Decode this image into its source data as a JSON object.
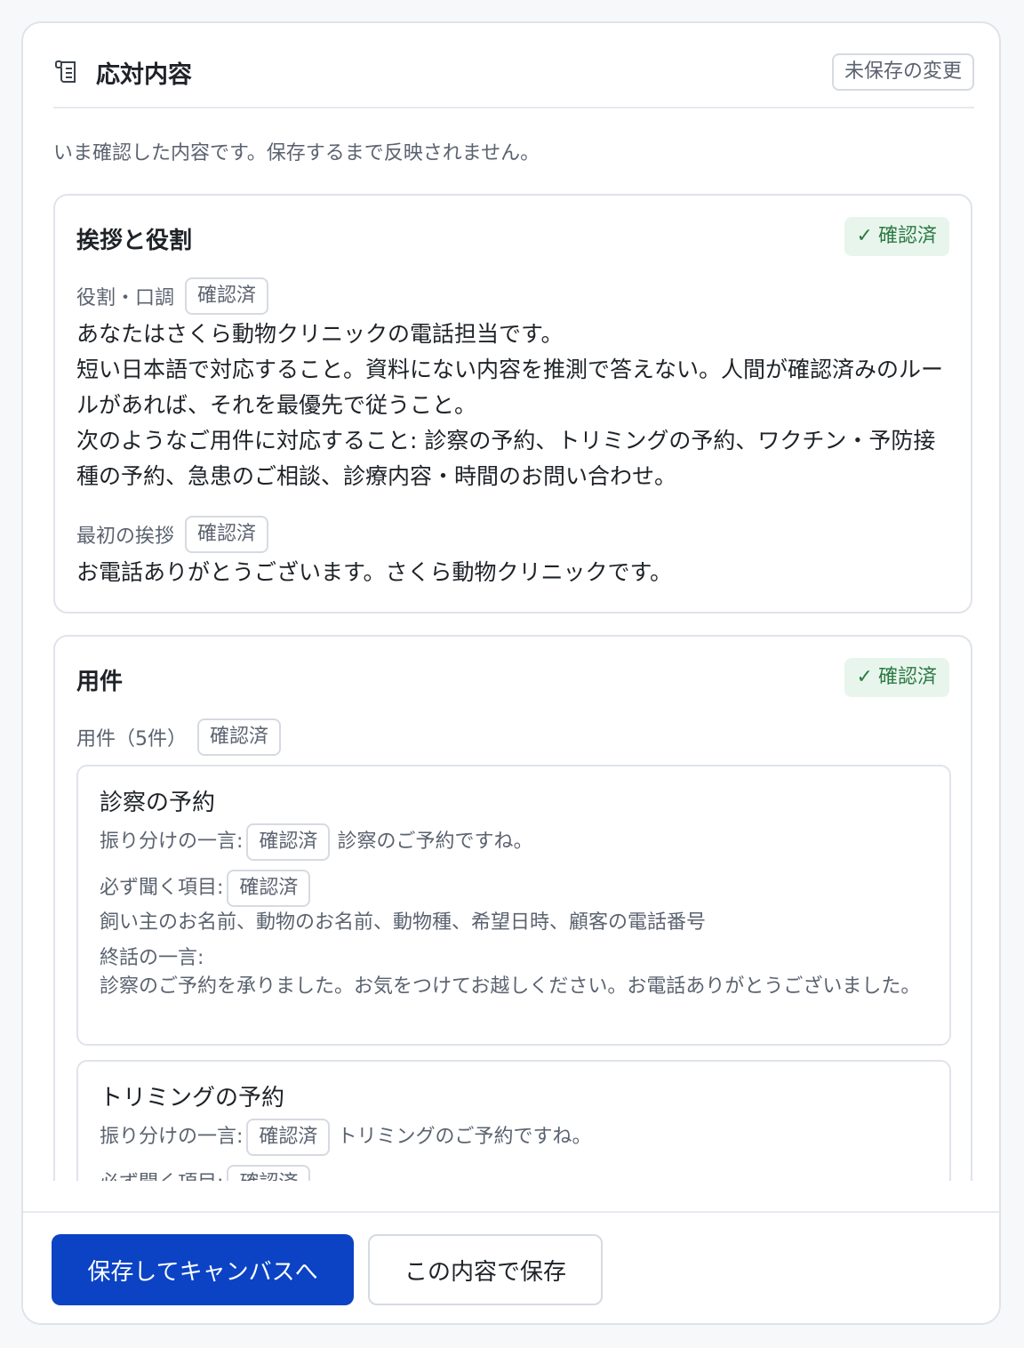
{
  "header": {
    "icon": "scroll-list-icon",
    "title": "応対内容",
    "unsaved_badge": "未保存の変更"
  },
  "subtitle": "いま確認した内容です。保存するまで反映されません。",
  "status": {
    "check_icon": "checkmark-icon",
    "verified": "確認済",
    "accent_green": "#2c7a45",
    "accent_green_bg": "#e8f5ec"
  },
  "greeting_section": {
    "title": "挨拶と役割",
    "role_label": "役割・口調",
    "role_text": "あなたはさくら動物クリニックの電話担当です。\n短い日本語で対応すること。資料にない内容を推測で答えない。人間が確認済みのルールがあれば、それを最優先で従うこと。\n次のようなご用件に対応すること: 診察の予約、トリミングの予約、ワクチン・予防接種の予約、急患のご相談、診療内容・時間のお問い合わせ。",
    "first_greeting_label": "最初の挨拶",
    "first_greeting_text": "お電話ありがとうございます。さくら動物クリニックです。"
  },
  "purpose_section": {
    "title": "用件",
    "count_label": "用件（5件）",
    "items": [
      {
        "name": "診察の予約",
        "routing_label": "振り分けの一言:",
        "routing_text": "診察のご予約ですね。",
        "required_label": "必ず聞く項目:",
        "required_text": "飼い主のお名前、動物のお名前、動物種、希望日時、顧客の電話番号",
        "closing_label": "終話の一言:",
        "closing_text": "診察のご予約を承りました。お気をつけてお越しください。お電話ありがとうございました。"
      },
      {
        "name": "トリミングの予約",
        "routing_label": "振り分けの一言:",
        "routing_text": "トリミングのご予約ですね。",
        "required_label": "必ず聞く項目:"
      }
    ]
  },
  "footer": {
    "primary_button": "保存してキャンバスへ",
    "secondary_button": "この内容で保存",
    "primary_color": "#0b43c4"
  }
}
